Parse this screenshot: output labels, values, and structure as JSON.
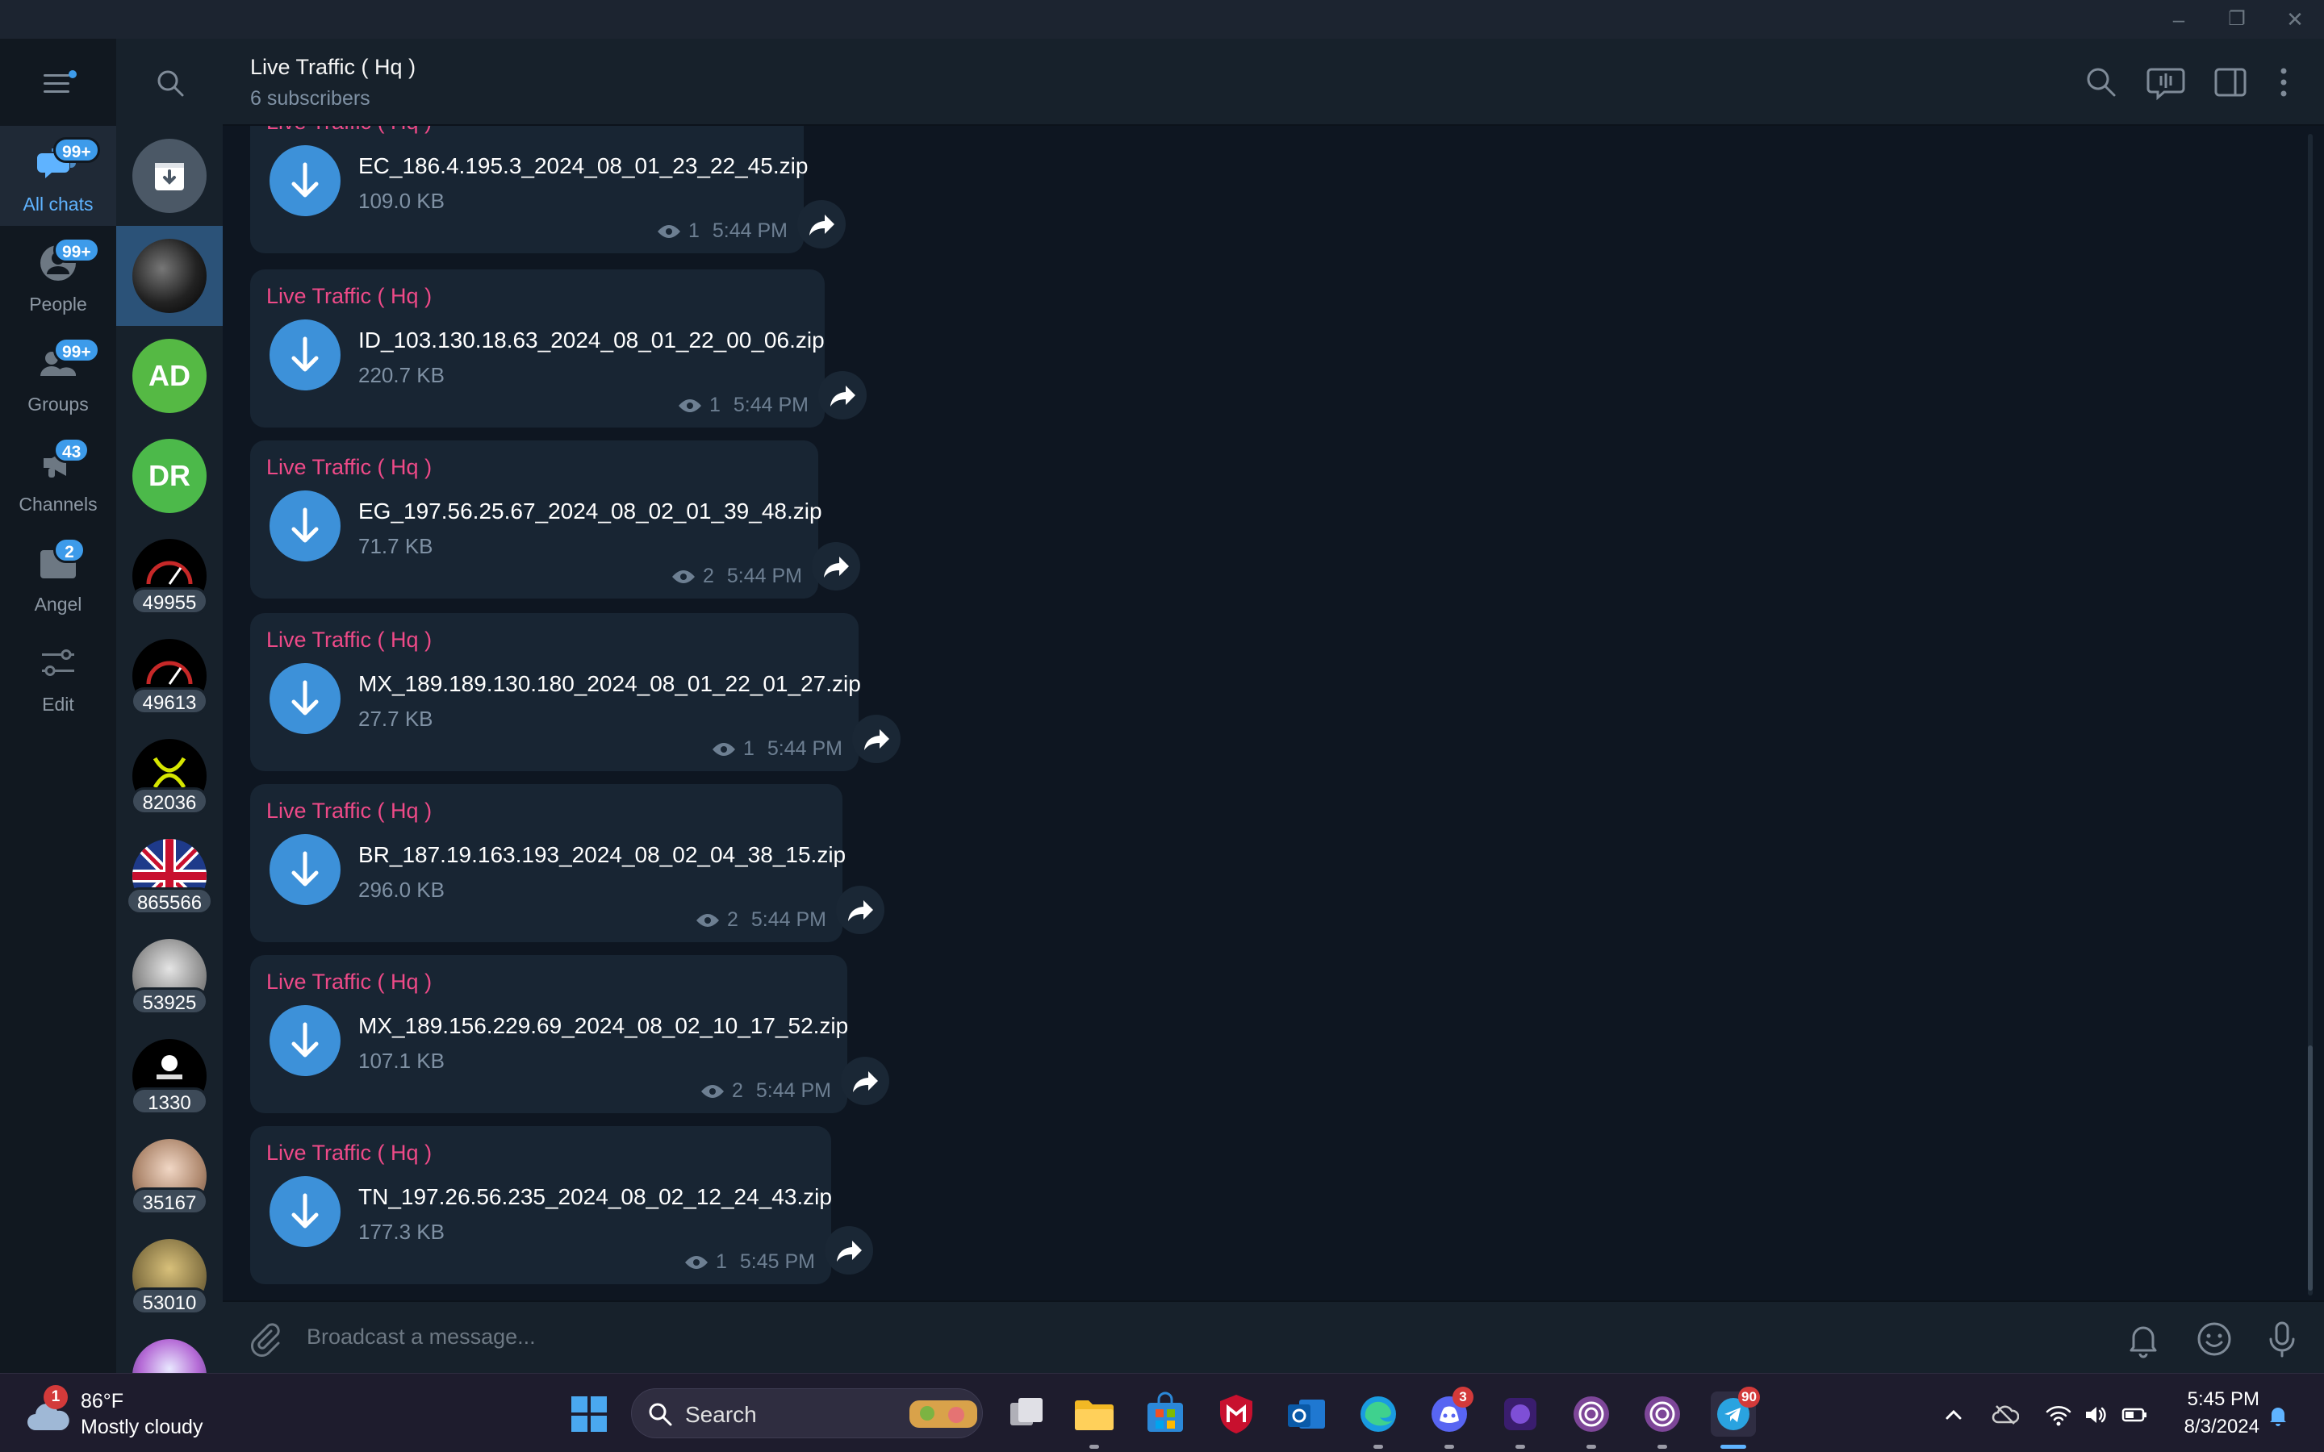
{
  "window": {
    "minimize": "–",
    "restore": "❐",
    "close": "✕"
  },
  "rail": {
    "folders": [
      {
        "label": "All chats",
        "badge": "99+",
        "icon": "chat-bubbles-icon",
        "active": true
      },
      {
        "label": "People",
        "badge": "99+",
        "icon": "person-icon",
        "active": false
      },
      {
        "label": "Groups",
        "badge": "99+",
        "icon": "group-icon",
        "active": false
      },
      {
        "label": "Channels",
        "badge": "43",
        "icon": "megaphone-icon",
        "active": false
      },
      {
        "label": "Angel",
        "badge": "2",
        "icon": "folder-icon",
        "active": false
      },
      {
        "label": "Edit",
        "badge": "",
        "icon": "sliders-icon",
        "active": false
      }
    ]
  },
  "chatlist": {
    "avatars": [
      {
        "kind": "archive",
        "count": ""
      },
      {
        "kind": "photo-dark",
        "count": "",
        "selected": true
      },
      {
        "kind": "initials",
        "initials": "AD",
        "color": "#55b944",
        "count": ""
      },
      {
        "kind": "initials",
        "initials": "DR",
        "color": "#4cb94a",
        "count": ""
      },
      {
        "kind": "speedometer",
        "count": "49955"
      },
      {
        "kind": "speedometer",
        "count": "49613"
      },
      {
        "kind": "yellow-logo",
        "count": "82036"
      },
      {
        "kind": "flag",
        "count": "865566"
      },
      {
        "kind": "character",
        "count": "53925"
      },
      {
        "kind": "skull-logo",
        "count": "1330"
      },
      {
        "kind": "photo-person",
        "count": "35167"
      },
      {
        "kind": "photo-gold",
        "count": "53010"
      },
      {
        "kind": "astronaut",
        "count": ""
      }
    ]
  },
  "header": {
    "title": "Live Traffic ( Hq )",
    "subtitle": "6 subscribers"
  },
  "messages": [
    {
      "sender": "Live Traffic ( Hq )",
      "file": "EC_186.4.195.3_2024_08_01_23_22_45.zip",
      "size": "109.0 KB",
      "views": "1",
      "time": "5:44 PM"
    },
    {
      "sender": "Live Traffic ( Hq )",
      "file": "ID_103.130.18.63_2024_08_01_22_00_06.zip",
      "size": "220.7 KB",
      "views": "1",
      "time": "5:44 PM"
    },
    {
      "sender": "Live Traffic ( Hq )",
      "file": "EG_197.56.25.67_2024_08_02_01_39_48.zip",
      "size": "71.7 KB",
      "views": "2",
      "time": "5:44 PM"
    },
    {
      "sender": "Live Traffic ( Hq )",
      "file": "MX_189.189.130.180_2024_08_01_22_01_27.zip",
      "size": "27.7 KB",
      "views": "1",
      "time": "5:44 PM"
    },
    {
      "sender": "Live Traffic ( Hq )",
      "file": "BR_187.19.163.193_2024_08_02_04_38_15.zip",
      "size": "296.0 KB",
      "views": "2",
      "time": "5:44 PM"
    },
    {
      "sender": "Live Traffic ( Hq )",
      "file": "MX_189.156.229.69_2024_08_02_10_17_52.zip",
      "size": "107.1 KB",
      "views": "2",
      "time": "5:44 PM"
    },
    {
      "sender": "Live Traffic ( Hq )",
      "file": "TN_197.26.56.235_2024_08_02_12_24_43.zip",
      "size": "177.3 KB",
      "views": "1",
      "time": "5:45 PM"
    }
  ],
  "composer": {
    "placeholder": "Broadcast a message..."
  },
  "taskbar": {
    "weather_badge": "1",
    "weather_temp": "86°F",
    "weather_desc": "Mostly cloudy",
    "search_label": "Search",
    "discord_badge": "3",
    "telegram_badge": "90",
    "time": "5:45 PM",
    "date": "8/3/2024"
  },
  "colors": {
    "accent": "#3d91d9",
    "sender": "#ee4a88",
    "background": "#0e1621",
    "bubble": "#182533"
  }
}
